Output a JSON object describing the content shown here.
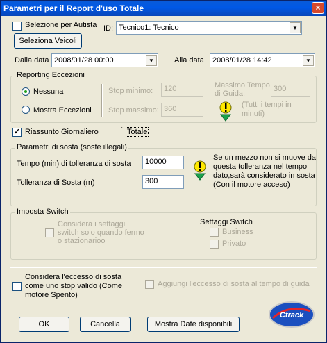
{
  "window": {
    "title": "Parametri per il Report d'uso Totale",
    "close": "×"
  },
  "top": {
    "selezione_autista": "Selezione per Autista",
    "seleziona_veicoli": "Seleziona Veicoli",
    "id_label": "ID:",
    "id_value": "Tecnico1: Tecnico",
    "dalla_label": "Dalla data",
    "dalla_value": "2008/01/28 00:00",
    "alla_label": "Alla data",
    "alla_value": "2008/01/28 14:42"
  },
  "eccezioni": {
    "legend": "Reporting Eccezioni",
    "nessuna": "Nessuna",
    "mostra": "Mostra Eccezioni",
    "stop_min_label": "Stop minimo:",
    "stop_min_value": "120",
    "stop_max_label": "Stop massimo:",
    "stop_max_value": "360",
    "max_guida_label": "Massimo Tempo di Guida:",
    "max_guida_value": "300",
    "note": "(Tutti i tempi in minuti)"
  },
  "options": {
    "riassunto": "Riassunto Giornaliero",
    "totale": "Totale"
  },
  "sosta": {
    "legend": "Parametri di sosta (soste illegali)",
    "tolleranza_label": "Tempo (min) di tolleranza di sosta",
    "tolleranza_value": "10000",
    "tolleranza_m_label": "Tolleranza di Sosta (m)",
    "tolleranza_m_value": "300",
    "note": "Se un mezzo non si muove da questa tolleranza nel tempo dato,sarà considerato in sosta (Con il motore acceso)"
  },
  "switch": {
    "legend": "Imposta Switch",
    "considera": "Considera i settaggi switch solo quando fermo o stazionarioo",
    "settaggi_label": "Settaggi Switch",
    "business": "Business",
    "privato": "Privato"
  },
  "bottom": {
    "eccesso": "Considera l'eccesso di sosta come uno stop valido (Come motore Spento)",
    "aggiungi": "Aggiungi l'eccesso di sosta al tempo di guida",
    "ok": "OK",
    "cancella": "Cancella",
    "mostra_date": "Mostra Date disponibili",
    "logo": "Ctrack"
  }
}
